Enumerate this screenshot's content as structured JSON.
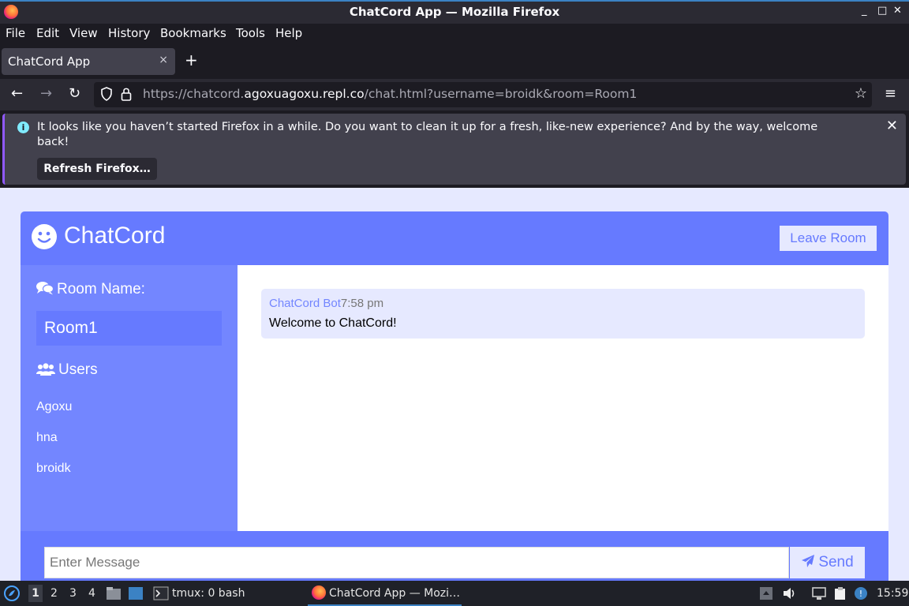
{
  "window": {
    "title": "ChatCord App — Mozilla Firefox",
    "controls": [
      "_",
      "□",
      "✕"
    ]
  },
  "menubar": [
    "File",
    "Edit",
    "View",
    "History",
    "Bookmarks",
    "Tools",
    "Help"
  ],
  "tabs": [
    {
      "label": "ChatCord App",
      "close": "×"
    }
  ],
  "new_tab": "+",
  "nav": {
    "back": "←",
    "forward": "→",
    "reload": "↻",
    "url_prefix": "https://chatcord.",
    "url_host": "agoxuagoxu.repl.co",
    "url_suffix": "/chat.html?username=broidk&room=Room1",
    "bookmark_star": "☆",
    "menu": "≡"
  },
  "notification": {
    "info_icon": "i",
    "text": "It looks like you haven’t started Firefox in a while. Do you want to clean it up for a fresh, like-new experience? And by the way, welcome back!",
    "button": "Refresh Firefox…",
    "close": "✕"
  },
  "app": {
    "title": "ChatCord",
    "leave_button": "Leave Room",
    "room_heading": "Room Name:",
    "room_name": "Room1",
    "users_heading": "Users",
    "users": [
      "Agoxu",
      "hna",
      "broidk"
    ],
    "messages": [
      {
        "user": "ChatCord Bot",
        "time": "7:58 pm",
        "text": "Welcome to ChatCord!"
      }
    ],
    "input_placeholder": "Enter Message",
    "send_button": "Send",
    "colors": {
      "primary": "#667aff",
      "secondary": "#7386ff",
      "light": "#e6e9ff"
    }
  },
  "taskbar": {
    "workspaces": [
      "1",
      "2",
      "3",
      "4"
    ],
    "terminal_label": "tmux: 0 bash",
    "firefox_label": "ChatCord App — Mozi…",
    "clock": "15:59"
  }
}
